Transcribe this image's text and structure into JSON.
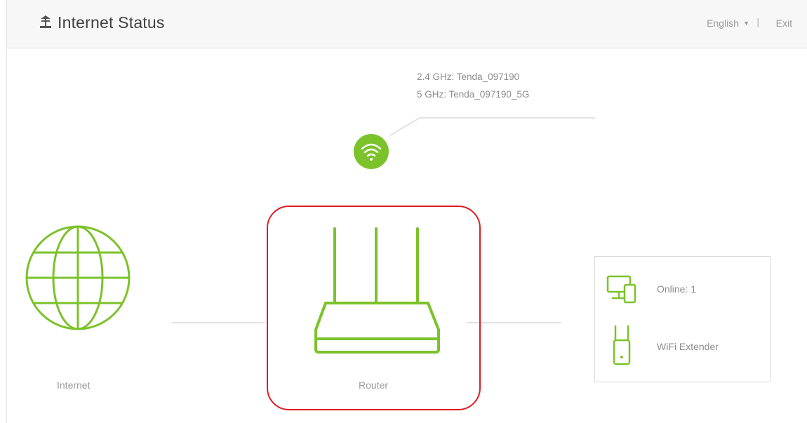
{
  "header": {
    "title": "Internet Status",
    "language": "English",
    "separator": "|",
    "exit_label": "Exit"
  },
  "wifi": {
    "ssid_24": "2.4 GHz: Tenda_097190",
    "ssid_5": "5 GHz: Tenda_097190_5G"
  },
  "nodes": {
    "internet_label": "Internet",
    "router_label": "Router"
  },
  "clients": {
    "online_text": "Online: 1",
    "extender_text": "WiFi Extender"
  },
  "colors": {
    "accent": "#7cc22a",
    "highlight": "#e11b22",
    "line": "#d9d9d9"
  }
}
